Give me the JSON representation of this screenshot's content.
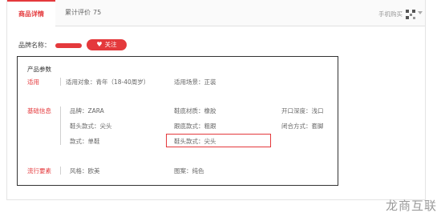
{
  "tabs": {
    "active_label": "商品详情",
    "review_label": "累计评价",
    "review_count": "75"
  },
  "mobile_buy_label": "手机购买",
  "brand": {
    "label": "品牌名称：",
    "follow_label": "关注"
  },
  "params": {
    "title": "产品参数",
    "categories": {
      "suitable": "适用",
      "basic": "基础信息",
      "trend": "流行要素"
    },
    "suitable": {
      "target": "适用对象：青年（18-40周岁）",
      "scene": "适用场景：正装"
    },
    "basic": {
      "brand": "品牌：ZARA",
      "toe_style": "鞋头款式：尖头",
      "style": "款式：单鞋",
      "sole_material": "鞋底材质：橡胶",
      "heel_style": "跟底款式：粗跟",
      "toe_style_highlight": "鞋头款式：尖头",
      "opening_depth": "开口深度：浅口",
      "closure": "闭合方式：套脚"
    },
    "trend": {
      "style": "风格：欧美",
      "pattern": "图案：纯色"
    }
  },
  "watermark": "龙商互联",
  "colors": {
    "accent": "#e4393c",
    "border": "#333333"
  }
}
